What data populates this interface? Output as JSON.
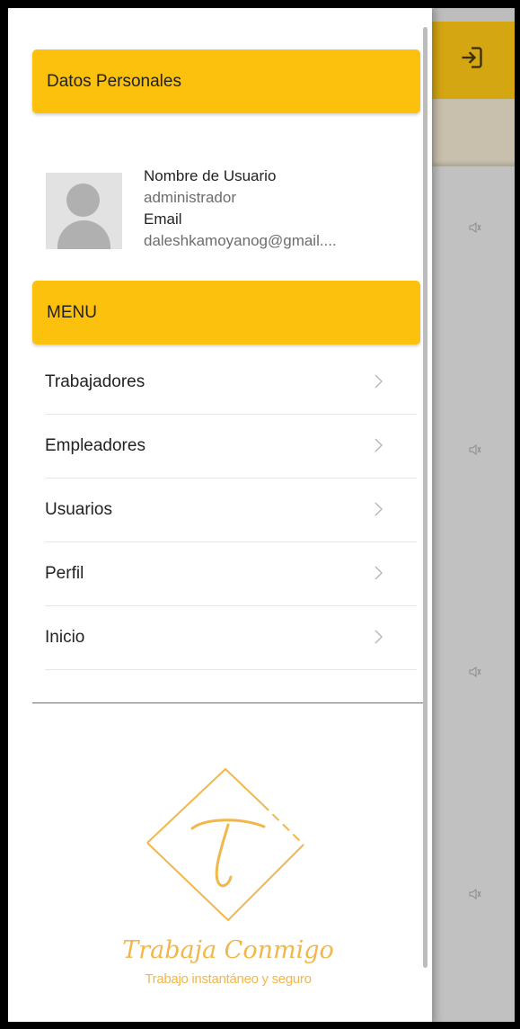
{
  "colors": {
    "accent": "#fcc10d",
    "toolbar": "#d4a612",
    "logo": "#f2b74a"
  },
  "drawer": {
    "personal_header": "Datos Personales",
    "user": {
      "username_label": "Nombre de Usuario",
      "username_value": "administrador",
      "email_label": "Email",
      "email_value": "daleshkamoyanog@gmail...."
    },
    "menu_header": "MENU",
    "menu_items": [
      {
        "label": "Trabajadores",
        "icon": "chevron-right-icon"
      },
      {
        "label": "Empleadores",
        "icon": "chevron-right-icon"
      },
      {
        "label": "Usuarios",
        "icon": "chevron-right-icon"
      },
      {
        "label": "Perfil",
        "icon": "chevron-right-icon"
      },
      {
        "label": "Inicio",
        "icon": "chevron-right-icon"
      }
    ],
    "logo": {
      "letter": "T",
      "brand_name": "Trabaja Conmigo",
      "tagline": "Trabajo instantáneo y seguro"
    }
  },
  "background_app": {
    "toolbar_icon": "login-icon",
    "card_icon": "speaker-icon"
  }
}
